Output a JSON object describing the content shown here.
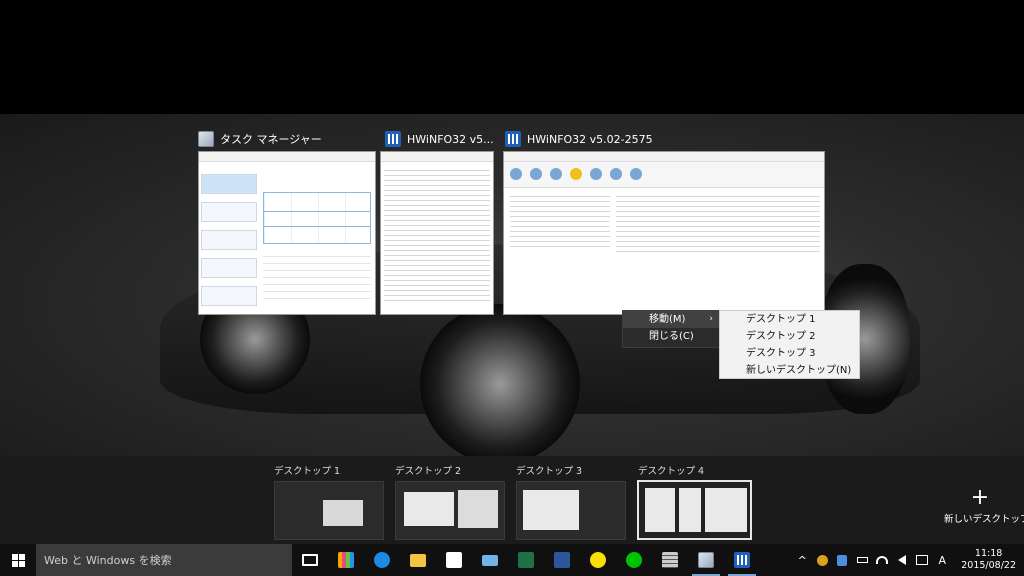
{
  "task_view": {
    "windows": [
      {
        "title": "タスク マネージャー",
        "icon": "task-manager-icon"
      },
      {
        "title": "HWiNFO32 v5...",
        "icon": "hwinfo-icon"
      },
      {
        "title": "HWiNFO32 v5.02-2575",
        "icon": "hwinfo-icon"
      }
    ],
    "context_menu": {
      "items": [
        "移動(M)",
        "閉じる(C)"
      ],
      "submenu_arrow": "›",
      "submenu": [
        "デスクトップ 1",
        "デスクトップ 2",
        "デスクトップ 3",
        "新しいデスクトップ(N)"
      ]
    }
  },
  "desktops": {
    "items": [
      "デスクトップ 1",
      "デスクトップ 2",
      "デスクトップ 3",
      "デスクトップ 4"
    ],
    "active_index": 3,
    "new_desktop_label": "新しいデスクトップ",
    "new_desktop_symbol": "+"
  },
  "taskbar": {
    "search_placeholder": "Web と Windows を検索",
    "pinned": [
      {
        "name": "task-view-icon",
        "color": "#ffffff"
      },
      {
        "name": "store-tiles-icon",
        "color": "#f7a600"
      },
      {
        "name": "edge-icon",
        "color": "#1e88e5"
      },
      {
        "name": "file-explorer-icon",
        "color": "#f4c542"
      },
      {
        "name": "store-icon",
        "color": "#ffffff"
      },
      {
        "name": "laptop-icon",
        "color": "#6fb3e8"
      },
      {
        "name": "excel-icon",
        "color": "#1e7145"
      },
      {
        "name": "word-icon",
        "color": "#2b579a"
      },
      {
        "name": "kakaotalk-icon",
        "color": "#f9e000"
      },
      {
        "name": "line-icon",
        "color": "#00c300"
      },
      {
        "name": "calculator-icon",
        "color": "#cccccc"
      },
      {
        "name": "task-manager-icon",
        "color": "#9ab0c4"
      },
      {
        "name": "hwinfo-icon",
        "color": "#1d62b8"
      }
    ],
    "tray": {
      "chevron": "^",
      "ime": "A",
      "time": "11:18",
      "date": "2015/08/22"
    }
  }
}
